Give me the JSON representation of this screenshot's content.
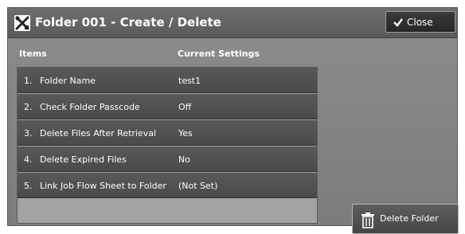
{
  "header": {
    "title": "Folder 001 - Create / Delete",
    "title_icon": "folder-tools-icon",
    "close_label": "Close"
  },
  "columns": {
    "items": "Items",
    "current_settings": "Current Settings"
  },
  "rows": [
    {
      "number": "1.",
      "item": "Folder Name",
      "value": "test1"
    },
    {
      "number": "2.",
      "item": "Check Folder Passcode",
      "value": "Off"
    },
    {
      "number": "3.",
      "item": "Delete Files After Retrieval",
      "value": "Yes"
    },
    {
      "number": "4.",
      "item": "Delete Expired Files",
      "value": "No"
    },
    {
      "number": "5.",
      "item": "Link Job Flow Sheet to Folder",
      "value": "(Not Set)"
    }
  ],
  "actions": {
    "delete_folder_label": "Delete Folder"
  },
  "colors": {
    "panel": "#7c7c7c",
    "header": "#5a5a5a",
    "row": "#4f4f4f",
    "text": "#ffffff"
  }
}
